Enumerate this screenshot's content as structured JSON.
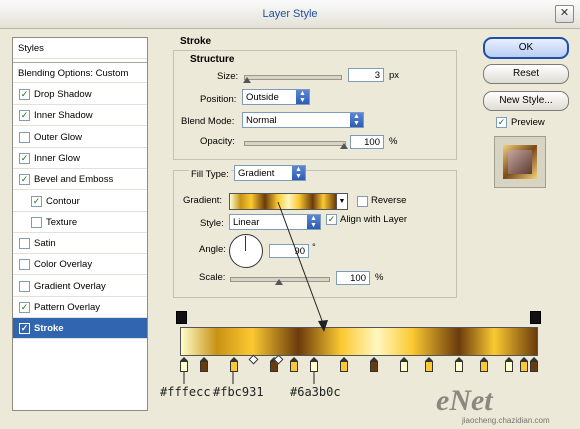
{
  "window": {
    "title": "Layer Style"
  },
  "left_panel": {
    "header": "Styles",
    "blending": "Blending Options: Custom",
    "items": [
      {
        "label": "Drop Shadow",
        "checked": true
      },
      {
        "label": "Inner Shadow",
        "checked": true
      },
      {
        "label": "Outer Glow",
        "checked": false
      },
      {
        "label": "Inner Glow",
        "checked": true
      },
      {
        "label": "Bevel and Emboss",
        "checked": true
      },
      {
        "label": "Contour",
        "checked": true
      },
      {
        "label": "Texture",
        "checked": false
      },
      {
        "label": "Satin",
        "checked": false
      },
      {
        "label": "Color Overlay",
        "checked": false
      },
      {
        "label": "Gradient Overlay",
        "checked": false
      },
      {
        "label": "Pattern Overlay",
        "checked": true
      },
      {
        "label": "Stroke",
        "checked": true
      }
    ]
  },
  "stroke": {
    "title": "Stroke",
    "structure_title": "Structure",
    "size_label": "Size:",
    "size_value": "3",
    "size_unit": "px",
    "size_level": 0.03,
    "position_label": "Position:",
    "position_value": "Outside",
    "blend_label": "Blend Mode:",
    "blend_value": "Normal",
    "opacity_label": "Opacity:",
    "opacity_value": "100",
    "opacity_unit": "%",
    "opacity_level": 1.0
  },
  "fill": {
    "type_label": "Fill Type:",
    "type_value": "Gradient",
    "gradient_label": "Gradient:",
    "reverse_label": "Reverse",
    "reverse_checked": false,
    "style_label": "Style:",
    "style_value": "Linear",
    "align_label": "Align with Layer",
    "align_checked": true,
    "angle_label": "Angle:",
    "angle_value": "90",
    "angle_unit": "°",
    "scale_label": "Scale:",
    "scale_value": "100",
    "scale_unit": "%",
    "scale_level": 0.5
  },
  "buttons": {
    "ok": "OK",
    "reset": "Reset",
    "new_style": "New Style...",
    "preview": "Preview",
    "preview_checked": true
  },
  "editor": {
    "hex_labels": [
      "#fffecc",
      "#fbc931",
      "#6a3b0c"
    ],
    "colors": {
      "light": "#fffecc",
      "gold": "#fbc931",
      "brown": "#6a3b0c"
    }
  },
  "watermark": {
    "brand": "eNet",
    "site": "jiaocheng.chazidian.com"
  }
}
